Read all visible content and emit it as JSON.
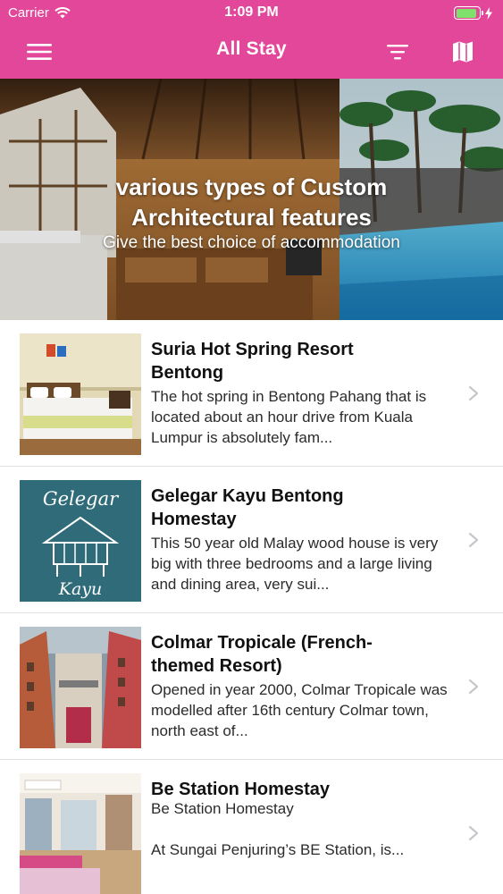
{
  "status_bar": {
    "carrier": "Carrier",
    "time": "1:09 PM",
    "battery_level": 0.9
  },
  "nav": {
    "title": "All Stay",
    "menu_icon": "hamburger-menu-icon",
    "filter_icon": "filter-icon",
    "map_icon": "map-icon"
  },
  "banner": {
    "headline": "various types of Custom Architectural features",
    "tagline": "Give the best choice of accommodation"
  },
  "listings": [
    {
      "title": "Suria Hot Spring Resort Bentong",
      "description": "The hot spring in Bentong Pahang that is located about an hour drive from Kuala Lumpur is absolutely fam..."
    },
    {
      "title": "Gelegar Kayu Bentong Homestay",
      "description": "This 50 year old Malay wood house is very big with three bedrooms and a large living and dining area, very sui...",
      "thumb_text_top": "Gelegar",
      "thumb_text_bottom": "Kayu"
    },
    {
      "title": "Colmar Tropicale (French-themed Resort)",
      "description": "Opened in year 2000, Colmar Tropicale was modelled after 16th century Colmar town, north east of..."
    },
    {
      "title": "Be Station Homestay",
      "subtitle": "Be Station Homestay",
      "description": "At Sungai Penjuring’s BE Station, is..."
    }
  ],
  "colors": {
    "brand_pink": "#e2479a",
    "battery_green": "#7fe06b",
    "chevron_gray": "#c7c7cc"
  }
}
